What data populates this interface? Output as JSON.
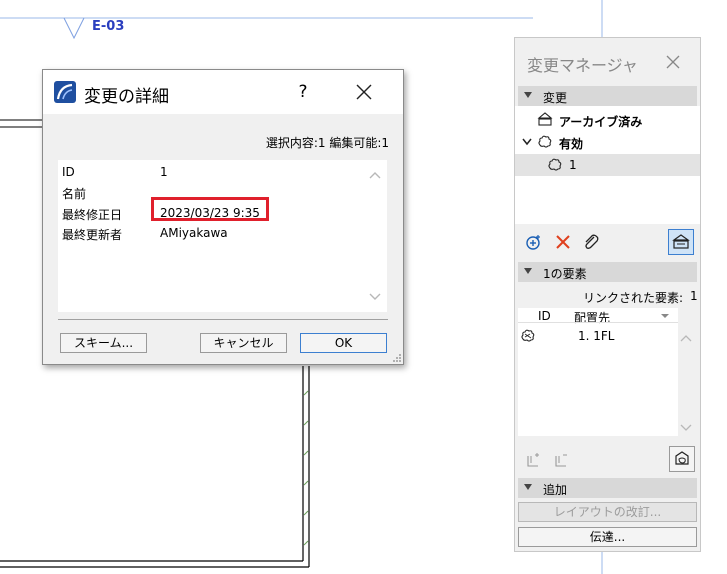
{
  "drawing": {
    "elevation_label": "E-03"
  },
  "dialog": {
    "title": "変更の詳細",
    "help_label": "?",
    "selection_info": "選択内容:1 編集可能:1",
    "fields": [
      {
        "label": "ID",
        "value": "1"
      },
      {
        "label": "名前",
        "value": ""
      },
      {
        "label": "最終修正日",
        "value": "2023/03/23 9:35"
      },
      {
        "label": "最終更新者",
        "value": "AMiyakawa"
      }
    ],
    "buttons": {
      "scheme": "スキーム...",
      "cancel": "キャンセル",
      "ok": "OK"
    }
  },
  "palette": {
    "title": "変更マネージャ",
    "section_changes": "変更",
    "tree": {
      "archived": "アーカイブ済み",
      "active": "有効",
      "item": "1"
    },
    "section_elements": "1の要素",
    "linked_label": "リンクされた要素:",
    "linked_count": "1",
    "columns": {
      "id": "ID",
      "location": "配置先"
    },
    "rows": [
      {
        "location": "1. 1FL"
      }
    ],
    "section_add": "追加",
    "layout_revision_button": "レイアウトの改訂...",
    "transmit_button": "伝達..."
  },
  "colors": {
    "highlight_red": "#e0202c",
    "elevation_blue": "#2b3fbf",
    "ok_border": "#3c7fd0"
  }
}
